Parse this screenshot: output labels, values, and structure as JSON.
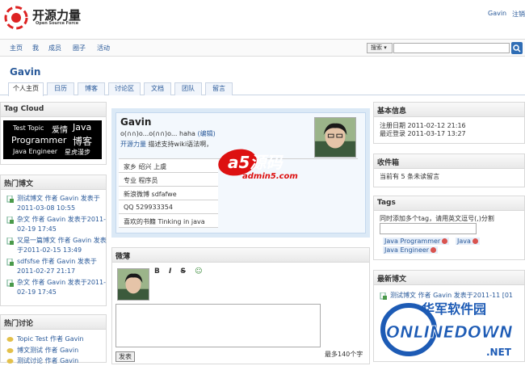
{
  "header": {
    "logo_name": "开源力量",
    "logo_sub": "Open Source Force",
    "user": "Gavin",
    "logout": "注销"
  },
  "nav": {
    "items": [
      "主页",
      "我",
      "成员",
      "圈子",
      "活动"
    ]
  },
  "search": {
    "scope": "搜索 ▾",
    "button_icon": "search-icon"
  },
  "page_title": "Gavin",
  "tabs": [
    "个人主页",
    "日历",
    "博客",
    "讨论区",
    "文档",
    "团队",
    "留言"
  ],
  "tag_cloud": {
    "title": "Tag Cloud",
    "tags": [
      "Test Topic",
      "爱情",
      "Java",
      "Programmer",
      "博客",
      "Java Engineer",
      "星虎漫步"
    ]
  },
  "hot_posts": {
    "title": "热门博文",
    "items": [
      "测试博文 作者 Gavin 发表于2011-03-08 10:55",
      "杂文 作者 Gavin 发表于2011-02-19 17:45",
      "又是一篇博文 作者 Gavin 发表于2011-02-15 13:49",
      "sdfsfse 作者 Gavin 发表于2011-02-27 21:17",
      "杂文 作者 Gavin 发表于2011-02-19 17:45"
    ]
  },
  "hot_topics": {
    "title": "热门讨论",
    "items": [
      "Topic Test 作者 Gavin",
      "博文测试 作者 Gavin",
      "测试讨论 作者 Gavin"
    ]
  },
  "profile": {
    "name": "Gavin",
    "motto": "o(∩∩)o...o(∩∩)o... haha",
    "edit": "(编辑)",
    "project": "开源力量",
    "project_desc": "描述支持wiki语法啊，",
    "info": [
      "家乡 绍兴 上虞",
      "专业 程序员",
      "新浪微博 sdfafwe",
      "QQ 529933354",
      "喜欢的书籍 Tinking in java"
    ]
  },
  "weibo": {
    "title": "微薄",
    "toolbar": [
      "B",
      "I",
      "S",
      "☺"
    ],
    "remain": "最多140个字",
    "publish": "发表"
  },
  "basic_info": {
    "title": "基本信息",
    "registered": "注册日期 2011-02-12 21:16",
    "last_login": "最近登录 2011-03-17 13:27"
  },
  "inbox": {
    "title": "收件箱",
    "text": "当前有 5 条未读留言"
  },
  "tags": {
    "title": "Tags",
    "hint": "同时添加多个tag，请用英文逗号(,)分割",
    "chips": [
      "Java Programmer",
      "Java",
      "Java Engineer"
    ]
  },
  "latest_posts": {
    "title": "最新博文",
    "item": "测试博文 作者 Gavin 发表于2011-11 [01"
  },
  "watermarks": [
    "a5源码",
    "admin5.com",
    "华军软件园",
    "ONLINEDOWN",
    ".NET"
  ],
  "colors": {
    "link": "#2a5a9a",
    "profile_bg": "#dbe9f6",
    "search_btn": "#2f6db5"
  }
}
